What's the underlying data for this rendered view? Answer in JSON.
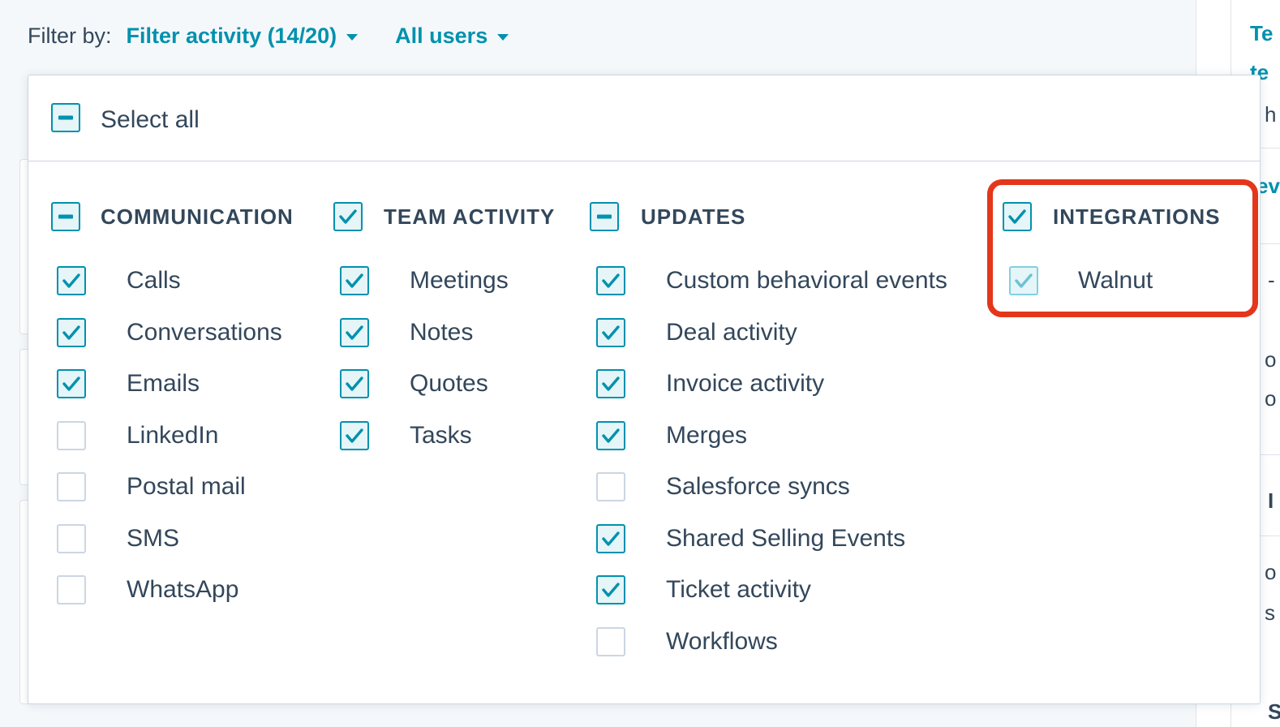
{
  "filter_bar": {
    "label": "Filter by:",
    "activity_filter": "Filter activity (14/20)",
    "user_filter": "All users"
  },
  "dropdown": {
    "select_all": {
      "label": "Select all",
      "state": "partial"
    },
    "columns": [
      {
        "header": "COMMUNICATION",
        "state": "partial",
        "items": [
          {
            "label": "Calls",
            "checked": true
          },
          {
            "label": "Conversations",
            "checked": true
          },
          {
            "label": "Emails",
            "checked": true
          },
          {
            "label": "LinkedIn",
            "checked": false
          },
          {
            "label": "Postal mail",
            "checked": false
          },
          {
            "label": "SMS",
            "checked": false
          },
          {
            "label": "WhatsApp",
            "checked": false
          }
        ]
      },
      {
        "header": "TEAM ACTIVITY",
        "state": "checked",
        "items": [
          {
            "label": "Meetings",
            "checked": true
          },
          {
            "label": "Notes",
            "checked": true
          },
          {
            "label": "Quotes",
            "checked": true
          },
          {
            "label": "Tasks",
            "checked": true
          }
        ]
      },
      {
        "header": "UPDATES",
        "state": "partial",
        "items": [
          {
            "label": "Custom behavioral events",
            "checked": true
          },
          {
            "label": "Deal activity",
            "checked": true
          },
          {
            "label": "Invoice activity",
            "checked": true
          },
          {
            "label": "Merges",
            "checked": true
          },
          {
            "label": "Salesforce syncs",
            "checked": false
          },
          {
            "label": "Shared Selling Events",
            "checked": true
          },
          {
            "label": "Ticket activity",
            "checked": true
          },
          {
            "label": "Workflows",
            "checked": false
          }
        ]
      },
      {
        "header": "INTEGRATIONS",
        "state": "checked",
        "items": [
          {
            "label": "Walnut",
            "checked": true
          }
        ]
      }
    ]
  },
  "right_pane": {
    "fragments": [
      "Te",
      "te",
      "h",
      "ev",
      "-",
      "o",
      "o",
      "I",
      "o",
      "s",
      "S"
    ]
  },
  "colors": {
    "accent": "#0091ae",
    "text": "#33475b",
    "border": "#cbd6e2",
    "highlight": "#e3361b"
  },
  "icons": {
    "check": "checkmark-icon",
    "partial": "minus-icon",
    "caret": "caret-down-icon"
  }
}
